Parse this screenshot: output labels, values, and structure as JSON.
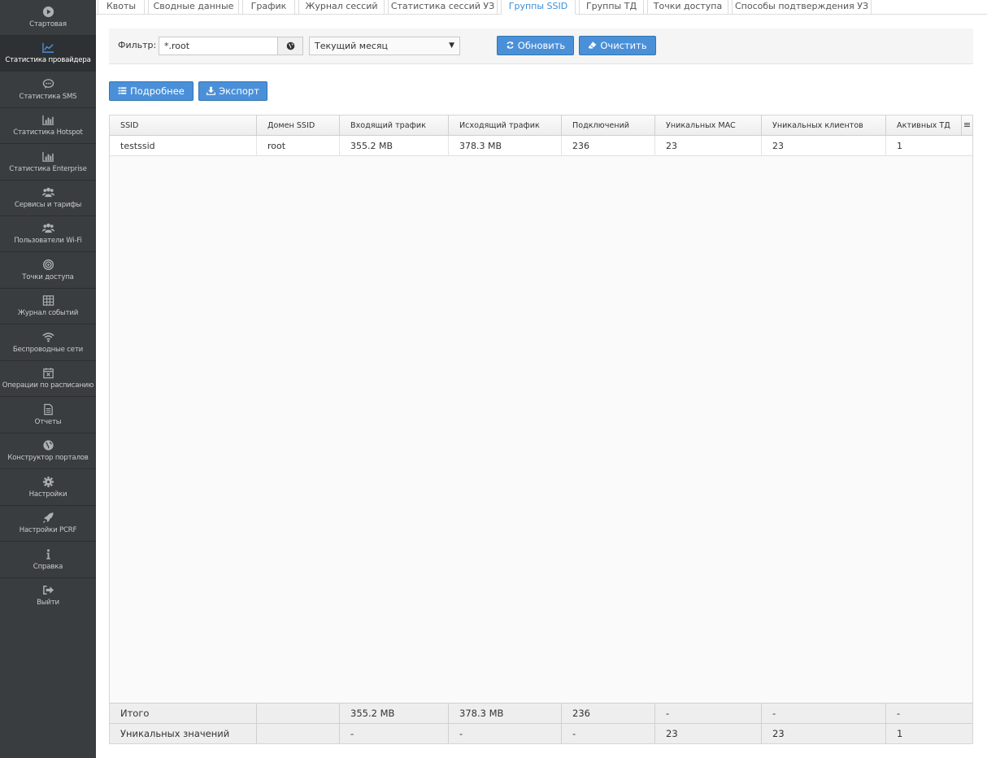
{
  "sidebar": {
    "items": [
      {
        "label": "Стартовая",
        "icon": "play-circle-icon"
      },
      {
        "label": "Статистика провайдера",
        "icon": "line-chart-icon"
      },
      {
        "label": "Статистика SMS",
        "icon": "comment-icon"
      },
      {
        "label": "Статистика Hotspot",
        "icon": "bar-chart-icon"
      },
      {
        "label": "Статистика Enterprise",
        "icon": "bar-chart-icon"
      },
      {
        "label": "Сервисы и тарифы",
        "icon": "users-icon"
      },
      {
        "label": "Пользователи Wi-Fi",
        "icon": "users-icon"
      },
      {
        "label": "Точки доступа",
        "icon": "bullseye-icon"
      },
      {
        "label": "Журнал событий",
        "icon": "table-icon"
      },
      {
        "label": "Беспроводные сети",
        "icon": "wifi-icon"
      },
      {
        "label": "Операции по расписанию",
        "icon": "calendar-x-icon"
      },
      {
        "label": "Отчеты",
        "icon": "file-text-icon"
      },
      {
        "label": "Конструктор порталов",
        "icon": "globe-icon"
      },
      {
        "label": "Настройки",
        "icon": "gear-icon"
      },
      {
        "label": "Настройки PCRF",
        "icon": "rocket-icon"
      },
      {
        "label": "Справка",
        "icon": "info-icon"
      },
      {
        "label": "Выйти",
        "icon": "sign-out-icon"
      }
    ],
    "active": "Статистика провайдера"
  },
  "tabs": [
    {
      "label": "Квоты"
    },
    {
      "label": "Сводные данные"
    },
    {
      "label": "График"
    },
    {
      "label": "Журнал сессий"
    },
    {
      "label": "Статистика сессий УЗ"
    },
    {
      "label": "Группы SSID"
    },
    {
      "label": "Группы ТД"
    },
    {
      "label": "Точки доступа"
    },
    {
      "label": "Способы подтверждения УЗ"
    }
  ],
  "active_tab": "Группы SSID",
  "filter": {
    "label": "Фильтр:",
    "value": "*.root",
    "period": "Текущий месяц",
    "refresh_label": "Обновить",
    "clear_label": "Очистить"
  },
  "toolbar": {
    "details_label": "Подробнее",
    "export_label": "Экспорт"
  },
  "table": {
    "columns": [
      "SSID",
      "Домен SSID",
      "Входящий трафик",
      "Исходящий трафик",
      "Подключений",
      "Уникальных MAC",
      "Уникальных клиентов",
      "Активных ТД"
    ],
    "rows": [
      [
        "testssid",
        "root",
        "355.2 MB",
        "378.3 MB",
        "236",
        "23",
        "23",
        "1"
      ]
    ],
    "summary": [
      [
        "Итого",
        "",
        "355.2 MB",
        "378.3 MB",
        "236",
        "-",
        "-",
        "-"
      ],
      [
        "Уникальных значений",
        "",
        "-",
        "-",
        "-",
        "23",
        "23",
        "1"
      ]
    ]
  },
  "colors": {
    "sidebar_bg": "#3a3d40",
    "accent": "#4a90d9",
    "active_tab": "#3b8fd6"
  }
}
